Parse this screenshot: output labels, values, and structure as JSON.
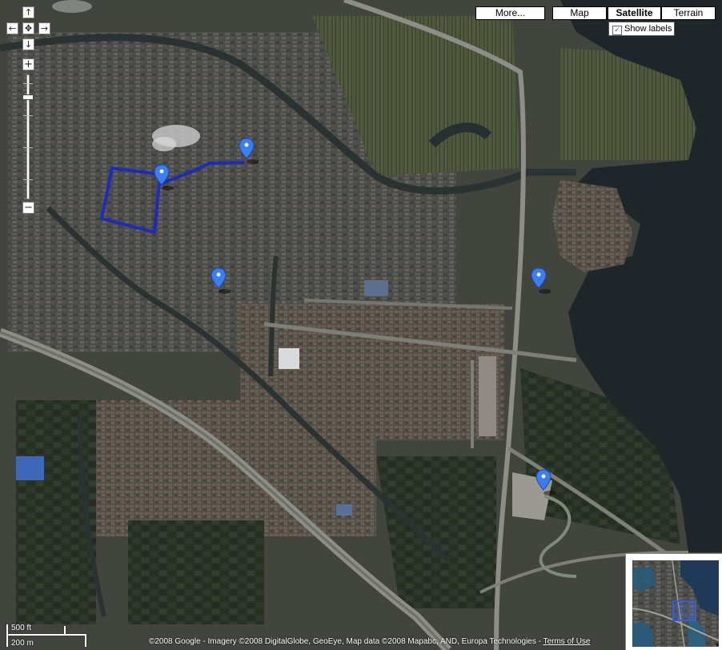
{
  "map": {
    "type_buttons": [
      {
        "label": "More...",
        "active": false
      },
      {
        "label": "Map",
        "active": false
      },
      {
        "label": "Satellite",
        "active": true
      },
      {
        "label": "Terrain",
        "active": false
      }
    ],
    "show_labels": {
      "label": "Show labels",
      "checked": true
    },
    "controls": {
      "pan_up": "↑",
      "pan_left": "←",
      "pan_center": "✥",
      "pan_right": "→",
      "pan_down": "↓",
      "zoom_in": "+",
      "zoom_out": "−"
    },
    "scale": {
      "imperial": "500 ft",
      "metric": "200 m"
    },
    "copyright": "©2008 Google - Imagery ©2008 DigitalGlobe, GeoEye, Map data ©2008 Mapabc, AND, Europa Technologies - ",
    "terms_link": "Terms of Use",
    "overview_toggle": "↘",
    "marker_count": 5,
    "route_color": "#1a27c9",
    "marker_color": "#3b7df2"
  }
}
